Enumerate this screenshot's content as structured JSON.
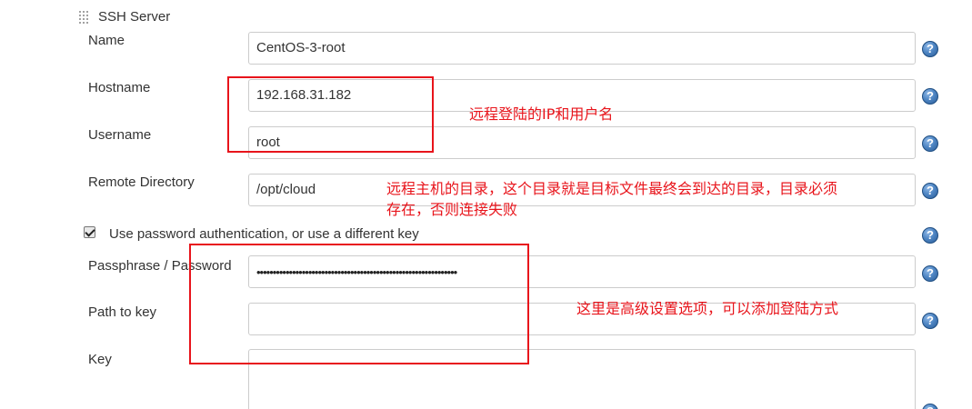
{
  "section": {
    "title": "SSH Server"
  },
  "fields": {
    "name": {
      "label": "Name",
      "value": "CentOS-3-root"
    },
    "hostname": {
      "label": "Hostname",
      "value": "192.168.31.182"
    },
    "username": {
      "label": "Username",
      "value": "root"
    },
    "remote_directory": {
      "label": "Remote Directory",
      "value": "/opt/cloud"
    },
    "passphrase": {
      "label": "Passphrase / Password",
      "value": "••••••••••••••••••••••••••••••••••••••••••••••••••••••••••••••"
    },
    "path_to_key": {
      "label": "Path to key",
      "value": ""
    },
    "key": {
      "label": "Key",
      "value": ""
    }
  },
  "use_password": {
    "label": "Use password authentication, or use a different key",
    "checked": true
  },
  "help_icon": {
    "glyph": "?",
    "icon": "help-icon",
    "color": "#4f86c4"
  },
  "annotations": {
    "color": "#e8141b",
    "login_note": "远程登陆的IP和用户名",
    "directory_note_line1": "远程主机的目录，这个目录就是目标文件最终会到达的目录，目录必须",
    "directory_note_line2": "存在，否则连接失败",
    "advanced_note": "这里是高级设置选项，可以添加登陆方式"
  }
}
